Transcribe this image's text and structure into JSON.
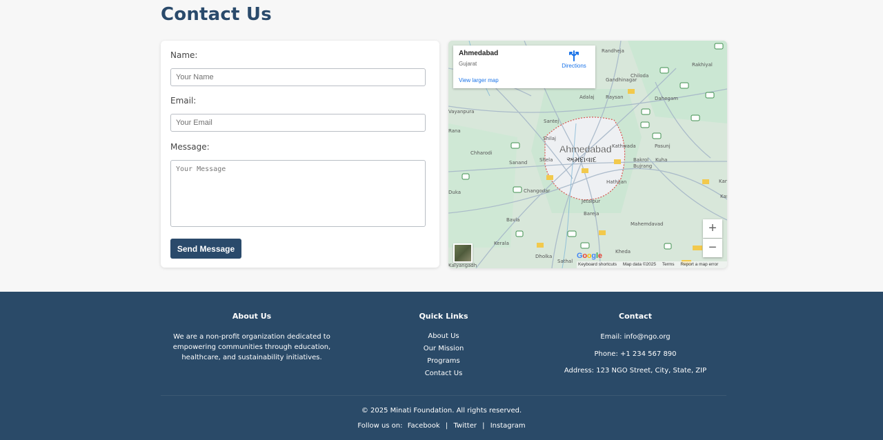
{
  "page": {
    "title": "Contact Us"
  },
  "form": {
    "name_label": "Name:",
    "name_placeholder": "Your Name",
    "email_label": "Email:",
    "email_placeholder": "Your Email",
    "message_label": "Message:",
    "message_placeholder": "Your Message",
    "submit_label": "Send Message"
  },
  "map": {
    "place_name": "Ahmedabad",
    "region": "Gujarat",
    "directions_label": "Directions",
    "larger_map_label": "View larger map",
    "city_label": "Ahmedabad",
    "city_label_local": "અમદાવાદ",
    "google_logo": "Google",
    "footer": [
      "Keyboard shortcuts",
      "Map data ©2025",
      "Terms",
      "Report a map error"
    ],
    "localities": [
      "Randheja",
      "Gandhinagar",
      "Chiloda",
      "Rakhiyal",
      "Adalaj",
      "Raysan",
      "Dahegam",
      "Santej",
      "Shilaj",
      "Kathwada",
      "Pasunj",
      "Chharodi",
      "Sanand",
      "Shela",
      "Bakrol Bujrang",
      "Kuha",
      "Changodar",
      "Hathijan",
      "Jetalpur",
      "Bareja",
      "Bavla",
      "Kerala",
      "Dholka",
      "Sathal",
      "Kheda",
      "Mahemdavad",
      "Kalyangadh",
      "Kani",
      "Vayanpura",
      "Duka",
      "Kasa"
    ],
    "colors": {
      "land": "#dfe4dc",
      "park": "#c5e7d1",
      "urban": "#f1f1f4",
      "road": "#8fa3b8",
      "highway_badge": "#f2c94c",
      "route_badge": "#3f8f4f"
    }
  },
  "footer": {
    "about": {
      "title": "About Us",
      "text_lines": [
        "We are a non-profit organization dedicated to",
        "empowering communities through education,",
        "healthcare, and sustainability initiatives."
      ]
    },
    "quick_links": {
      "title": "Quick Links",
      "items": [
        "About Us",
        "Our Mission",
        "Programs",
        "Contact Us"
      ]
    },
    "contact": {
      "title": "Contact",
      "email": "Email: info@ngo.org",
      "phone": "Phone: +1 234 567 890",
      "address": "Address: 123 NGO Street, City, State, ZIP"
    },
    "copyright": "© 2025 Minati Foundation. All rights reserved.",
    "follow_label": "Follow us on:",
    "social": [
      "Facebook",
      "Twitter",
      "Instagram"
    ],
    "social_separator": "|"
  }
}
